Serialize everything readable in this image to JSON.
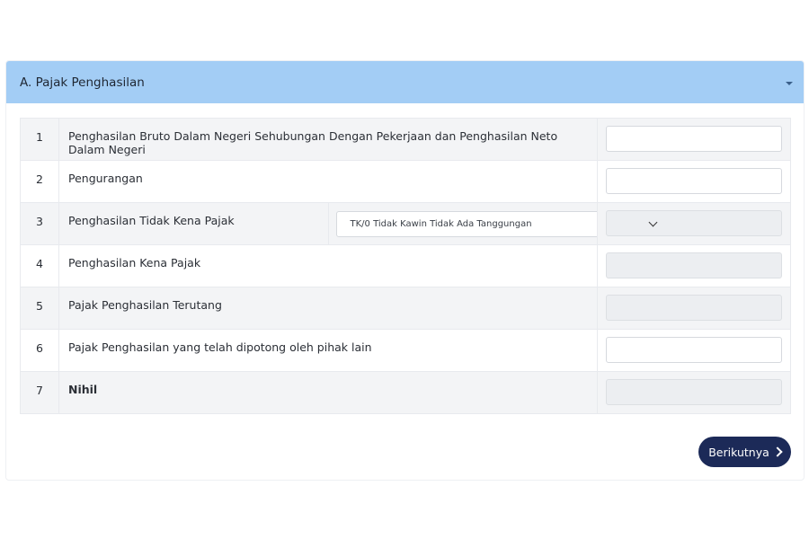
{
  "section": {
    "title": "A. Pajak Penghasilan",
    "toggle_icon": "caret-down-icon"
  },
  "rows": [
    {
      "num": "1",
      "label": "Penghasilan Bruto Dalam Negeri Sehubungan Dengan Pekerjaan dan Penghasilan Neto Dalam Negeri",
      "value": "",
      "editable": true
    },
    {
      "num": "2",
      "label": "Pengurangan",
      "value": "",
      "editable": true
    },
    {
      "num": "3",
      "label": "Penghasilan Tidak Kena Pajak",
      "select_value": "TK/0 Tidak Kawin Tidak Ada Tanggungan",
      "value": "",
      "editable": false
    },
    {
      "num": "4",
      "label": "Penghasilan Kena Pajak",
      "value": "",
      "editable": false
    },
    {
      "num": "5",
      "label": "Pajak Penghasilan Terutang",
      "value": "",
      "editable": false
    },
    {
      "num": "6",
      "label": "Pajak Penghasilan yang telah dipotong oleh pihak lain",
      "value": "",
      "editable": true
    },
    {
      "num": "7",
      "label": "Nihil",
      "value": "",
      "editable": false
    }
  ],
  "next_button": {
    "label": "Berikutnya",
    "icon": "chevron-right-icon"
  },
  "colors": {
    "header_bg": "#a3cdf5",
    "button_bg": "#1c2a58"
  }
}
